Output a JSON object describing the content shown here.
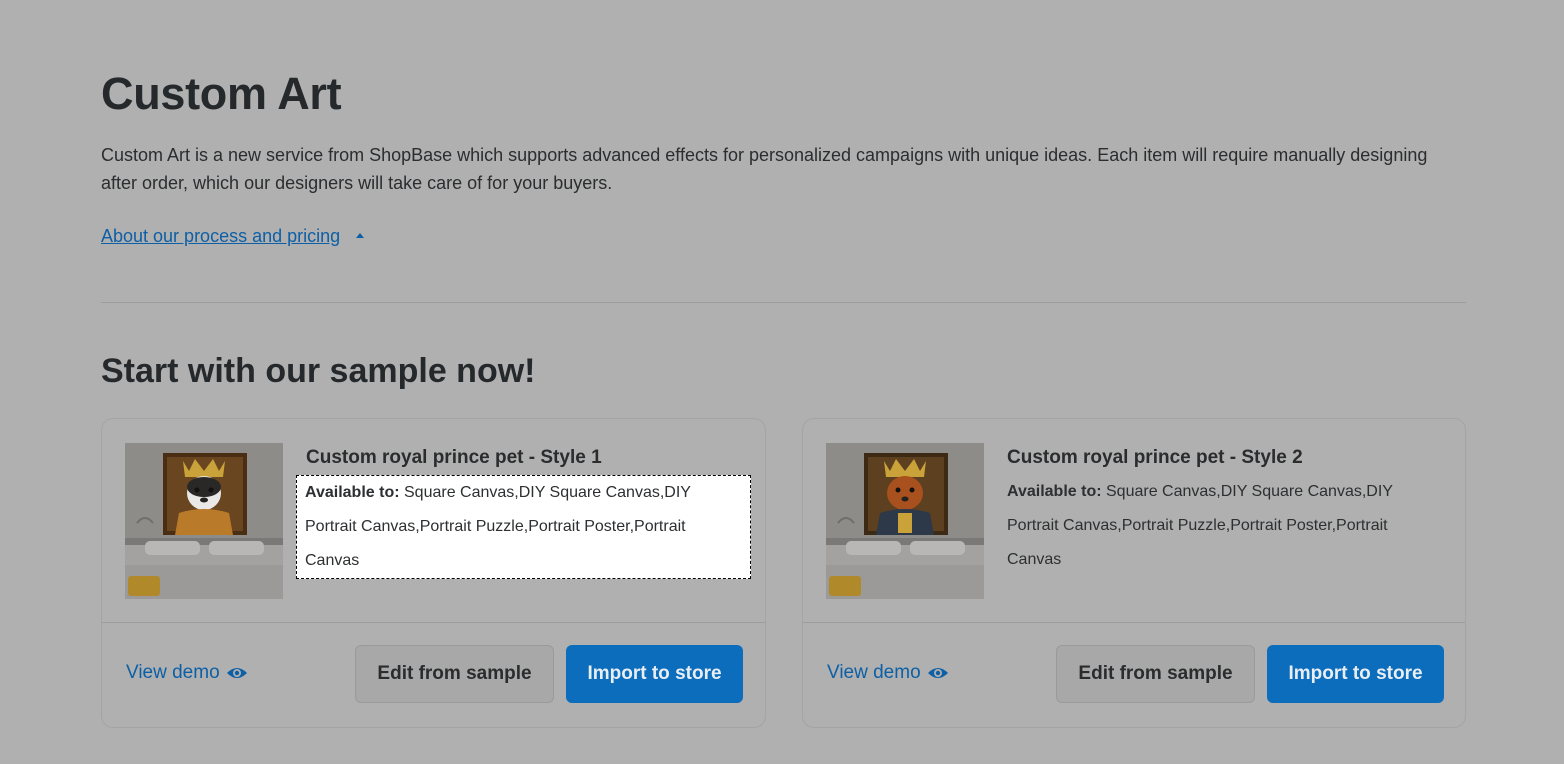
{
  "header": {
    "title": "Custom Art",
    "description": "Custom Art is a new service from ShopBase which supports advanced effects for personalized campaigns with unique ideas. Each item will require manually designing after order, which our designers will take care of for your buyers.",
    "about_link": "About our process and pricing"
  },
  "section": {
    "title": "Start with our sample now!"
  },
  "cards": [
    {
      "title": "Custom royal prince pet - Style 1",
      "available_label": "Available to:",
      "available_value": " Square Canvas,DIY Square Canvas,DIY Portrait Canvas,Portrait Puzzle,Portrait Poster,Portrait Canvas",
      "view_demo": "View demo",
      "edit_label": "Edit from sample",
      "import_label": "Import to store"
    },
    {
      "title": "Custom royal prince pet - Style 2",
      "available_label": "Available to:",
      "available_value": " Square Canvas,DIY Square Canvas,DIY Portrait Canvas,Portrait Puzzle,Portrait Poster,Portrait Canvas",
      "view_demo": "View demo",
      "edit_label": "Edit from sample",
      "import_label": "Import to store"
    }
  ],
  "icons": {
    "caret": "caret-up-icon",
    "eye": "eye-icon"
  },
  "colors": {
    "accent": "#0b6dbb",
    "link": "#0d5fa6",
    "overlay": "#b0b0b0"
  }
}
